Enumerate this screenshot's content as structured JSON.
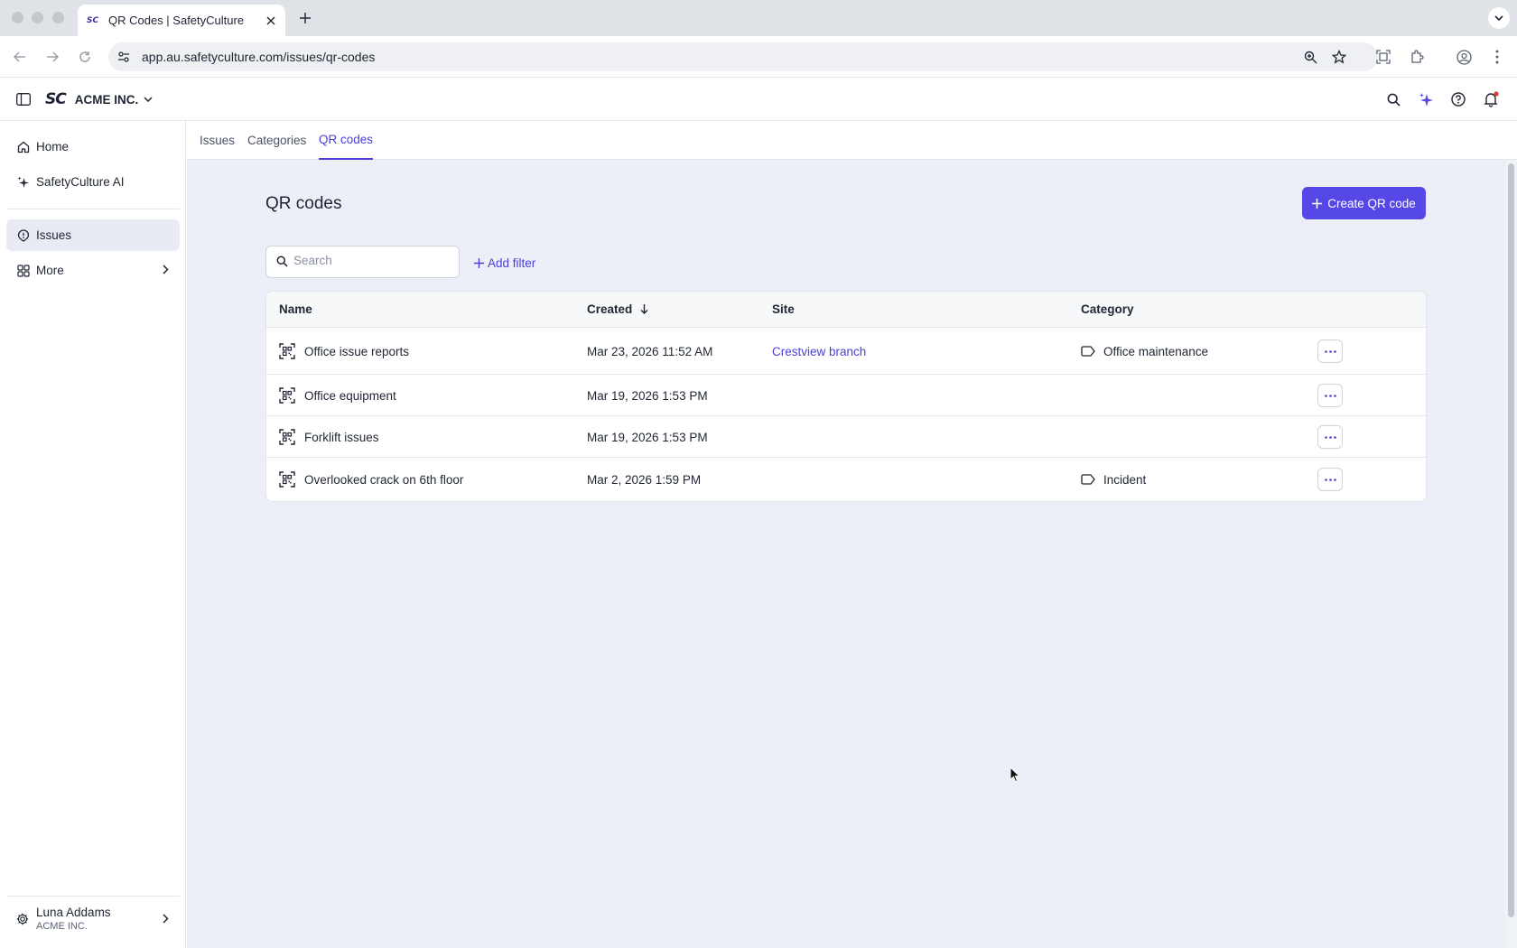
{
  "browser": {
    "tab_title": "QR Codes | SafetyCulture",
    "tab_favicon": "SC",
    "url": "app.au.safetyculture.com/issues/qr-codes"
  },
  "header": {
    "logo_text": "SC",
    "org_name": "ACME INC."
  },
  "sidebar": {
    "items": [
      {
        "label": "Home",
        "icon": "home-icon"
      },
      {
        "label": "SafetyCulture AI",
        "icon": "sparkle-icon"
      },
      {
        "label": "Issues",
        "icon": "issues-icon"
      },
      {
        "label": "More",
        "icon": "grid-icon"
      }
    ],
    "user": {
      "name": "Luna Addams",
      "org": "ACME INC."
    }
  },
  "subtabs": [
    {
      "label": "Issues"
    },
    {
      "label": "Categories"
    },
    {
      "label": "QR codes"
    }
  ],
  "main": {
    "title": "QR codes",
    "create_label": "Create QR code",
    "search_placeholder": "Search",
    "add_filter_label": "Add filter"
  },
  "table": {
    "columns": {
      "name": "Name",
      "created": "Created",
      "site": "Site",
      "category": "Category"
    },
    "rows": [
      {
        "name": "Office issue reports",
        "created": "Mar 23, 2026 11:52 AM",
        "site": "Crestview branch",
        "category": "Office maintenance"
      },
      {
        "name": "Office equipment",
        "created": "Mar 19, 2026 1:53 PM",
        "site": "",
        "category": ""
      },
      {
        "name": "Forklift issues",
        "created": "Mar 19, 2026 1:53 PM",
        "site": "",
        "category": ""
      },
      {
        "name": "Overlooked crack on 6th floor",
        "created": "Mar 2, 2026 1:59 PM",
        "site": "",
        "category": "Incident"
      }
    ]
  },
  "colors": {
    "accent": "#5548e6",
    "link": "#4b40d6",
    "main_bg": "#eceff8"
  }
}
